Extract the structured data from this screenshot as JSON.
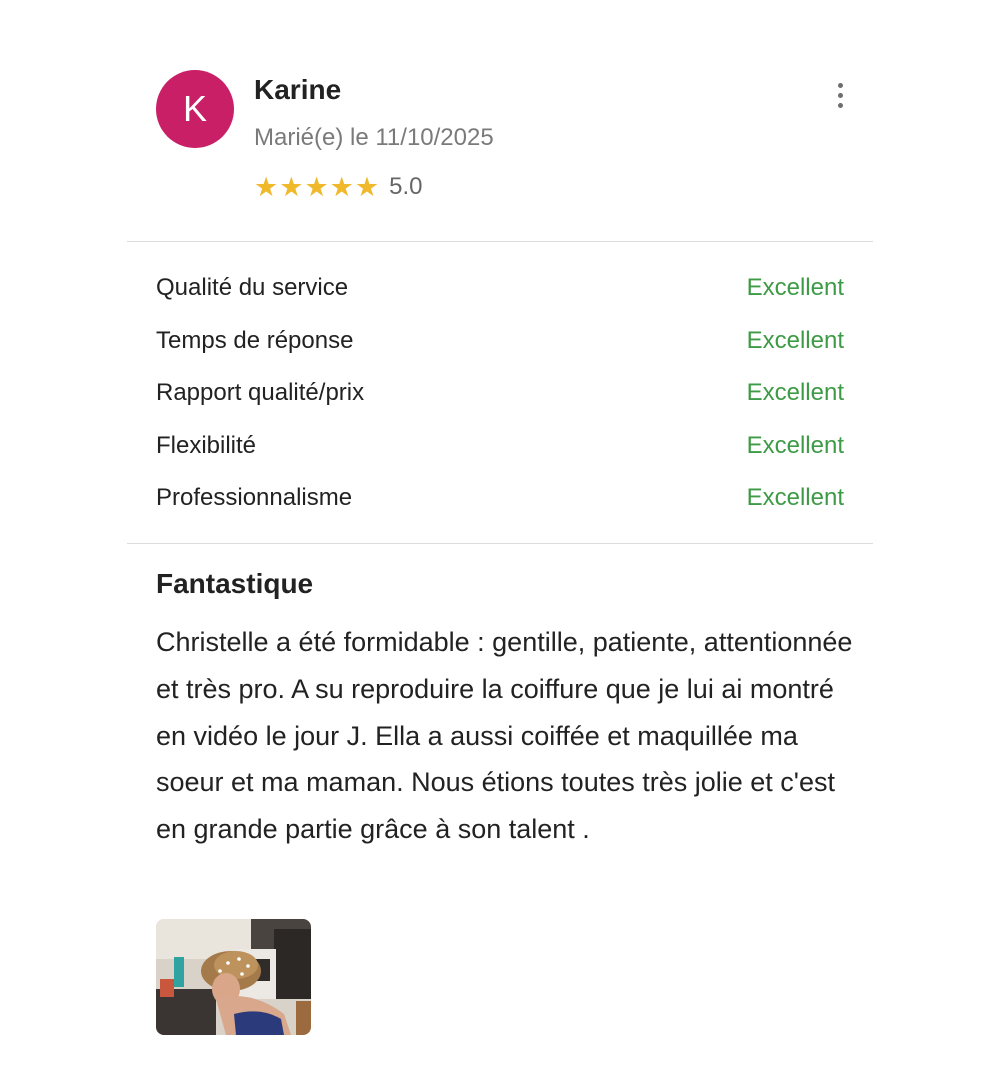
{
  "review": {
    "author": {
      "initial": "K",
      "name": "Karine",
      "married_date": "Marié(e) le 11/10/2025",
      "avatar_color": "#c81f66"
    },
    "rating": {
      "stars": 5,
      "max": 5,
      "value": "5.0"
    },
    "menu_icon": "more-vertical-icon",
    "scores": [
      {
        "label": "Qualité du service",
        "value": "Excellent"
      },
      {
        "label": "Temps de réponse",
        "value": "Excellent"
      },
      {
        "label": "Rapport qualité/prix",
        "value": "Excellent"
      },
      {
        "label": "Flexibilité",
        "value": "Excellent"
      },
      {
        "label": "Professionnalisme",
        "value": "Excellent"
      }
    ],
    "title": "Fantastique",
    "text": "Christelle a été formidable : gentille, patiente, attentionnée et très pro. A su reproduire la coiffure que je lui ai montré en vidéo le jour J. Ella a aussi coiffée et maquillée ma soeur et ma maman. Nous étions toutes très jolie et c'est en grande partie grâce à son talent .",
    "colors": {
      "star": "#f0b92b",
      "score": "#3e9b45",
      "muted": "#7a7a7a"
    }
  }
}
